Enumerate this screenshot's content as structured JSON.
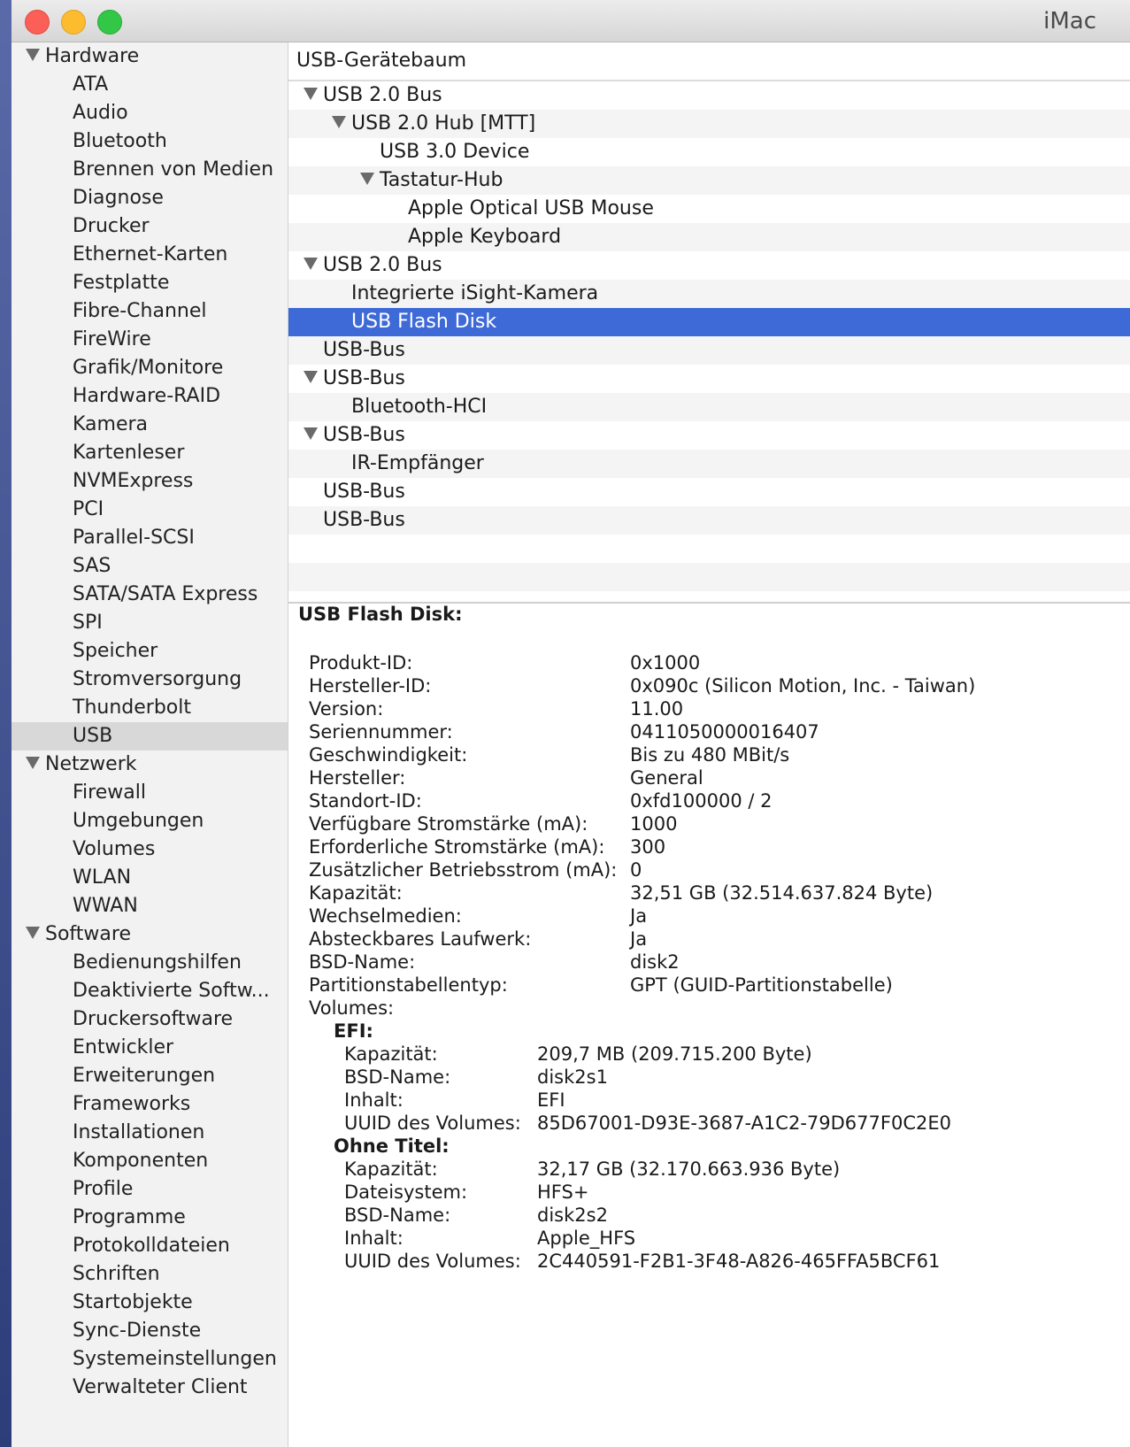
{
  "window": {
    "title": "iMac"
  },
  "sidebar": {
    "groups": [
      {
        "label": "Hardware",
        "items": [
          "ATA",
          "Audio",
          "Bluetooth",
          "Brennen von Medien",
          "Diagnose",
          "Drucker",
          "Ethernet-Karten",
          "Festplatte",
          "Fibre-Channel",
          "FireWire",
          "Grafik/Monitore",
          "Hardware-RAID",
          "Kamera",
          "Kartenleser",
          "NVMExpress",
          "PCI",
          "Parallel-SCSI",
          "SAS",
          "SATA/SATA Express",
          "SPI",
          "Speicher",
          "Stromversorgung",
          "Thunderbolt",
          "USB"
        ]
      },
      {
        "label": "Netzwerk",
        "items": [
          "Firewall",
          "Umgebungen",
          "Volumes",
          "WLAN",
          "WWAN"
        ]
      },
      {
        "label": "Software",
        "items": [
          "Bedienungshilfen",
          "Deaktivierte Softw...",
          "Druckersoftware",
          "Entwickler",
          "Erweiterungen",
          "Frameworks",
          "Installationen",
          "Komponenten",
          "Profile",
          "Programme",
          "Protokolldateien",
          "Schriften",
          "Startobjekte",
          "Sync-Dienste",
          "Systemeinstellungen",
          "Verwalteter Client"
        ]
      }
    ],
    "selected": "USB"
  },
  "tree": {
    "header": "USB-Gerätebaum",
    "rows": [
      {
        "label": "USB 2.0 Bus",
        "level": 0,
        "expanded": true
      },
      {
        "label": "USB 2.0 Hub [MTT]",
        "level": 1,
        "expanded": true
      },
      {
        "label": "USB 3.0 Device",
        "level": 2,
        "expanded": false
      },
      {
        "label": "Tastatur-Hub",
        "level": 2,
        "expanded": true
      },
      {
        "label": "Apple Optical USB Mouse",
        "level": 3,
        "expanded": false
      },
      {
        "label": "Apple Keyboard",
        "level": 3,
        "expanded": false
      },
      {
        "label": "USB 2.0 Bus",
        "level": 0,
        "expanded": true
      },
      {
        "label": "Integrierte iSight-Kamera",
        "level": 1,
        "expanded": false
      },
      {
        "label": "USB Flash Disk",
        "level": 1,
        "expanded": false,
        "selected": true
      },
      {
        "label": "USB-Bus",
        "level": 0,
        "expanded": false
      },
      {
        "label": "USB-Bus",
        "level": 0,
        "expanded": true
      },
      {
        "label": "Bluetooth-HCI",
        "level": 1,
        "expanded": false
      },
      {
        "label": "USB-Bus",
        "level": 0,
        "expanded": true
      },
      {
        "label": "IR-Empfänger",
        "level": 1,
        "expanded": false
      },
      {
        "label": "USB-Bus",
        "level": 0,
        "expanded": false
      },
      {
        "label": "USB-Bus",
        "level": 0,
        "expanded": false
      }
    ]
  },
  "detail": {
    "title": "USB Flash Disk:",
    "props": [
      {
        "k": "Produkt-ID:",
        "v": "0x1000"
      },
      {
        "k": "Hersteller-ID:",
        "v": "0x090c  (Silicon Motion, Inc. - Taiwan)"
      },
      {
        "k": "Version:",
        "v": "11.00"
      },
      {
        "k": "Seriennummer:",
        "v": "0411050000016407"
      },
      {
        "k": "Geschwindigkeit:",
        "v": "Bis zu 480 MBit/s"
      },
      {
        "k": "Hersteller:",
        "v": "General"
      },
      {
        "k": "Standort-ID:",
        "v": "0xfd100000 / 2"
      },
      {
        "k": "Verfügbare Stromstärke (mA):",
        "v": "1000"
      },
      {
        "k": "Erforderliche Stromstärke (mA):",
        "v": "300"
      },
      {
        "k": "Zusätzlicher Betriebsstrom (mA):",
        "v": "0"
      },
      {
        "k": "Kapazität:",
        "v": "32,51 GB (32.514.637.824 Byte)"
      },
      {
        "k": "Wechselmedien:",
        "v": "Ja"
      },
      {
        "k": "Absteckbares Laufwerk:",
        "v": "Ja"
      },
      {
        "k": "BSD-Name:",
        "v": "disk2"
      },
      {
        "k": "Partitionstabellentyp:",
        "v": "GPT (GUID-Partitionstabelle)"
      },
      {
        "k": "Volumes:",
        "v": ""
      }
    ],
    "volumes": [
      {
        "title": "EFI:",
        "props": [
          {
            "k": "Kapazität:",
            "v": "209,7 MB (209.715.200 Byte)"
          },
          {
            "k": "BSD-Name:",
            "v": "disk2s1"
          },
          {
            "k": "Inhalt:",
            "v": "EFI"
          },
          {
            "k": "UUID des Volumes:",
            "v": "85D67001-D93E-3687-A1C2-79D677F0C2E0"
          }
        ]
      },
      {
        "title": "Ohne Titel:",
        "props": [
          {
            "k": "Kapazität:",
            "v": "32,17 GB (32.170.663.936 Byte)"
          },
          {
            "k": "Dateisystem:",
            "v": "HFS+"
          },
          {
            "k": "BSD-Name:",
            "v": "disk2s2"
          },
          {
            "k": "Inhalt:",
            "v": "Apple_HFS"
          },
          {
            "k": "UUID des Volumes:",
            "v": "2C440591-F2B1-3F48-A826-465FFA5BCF61"
          }
        ]
      }
    ]
  }
}
